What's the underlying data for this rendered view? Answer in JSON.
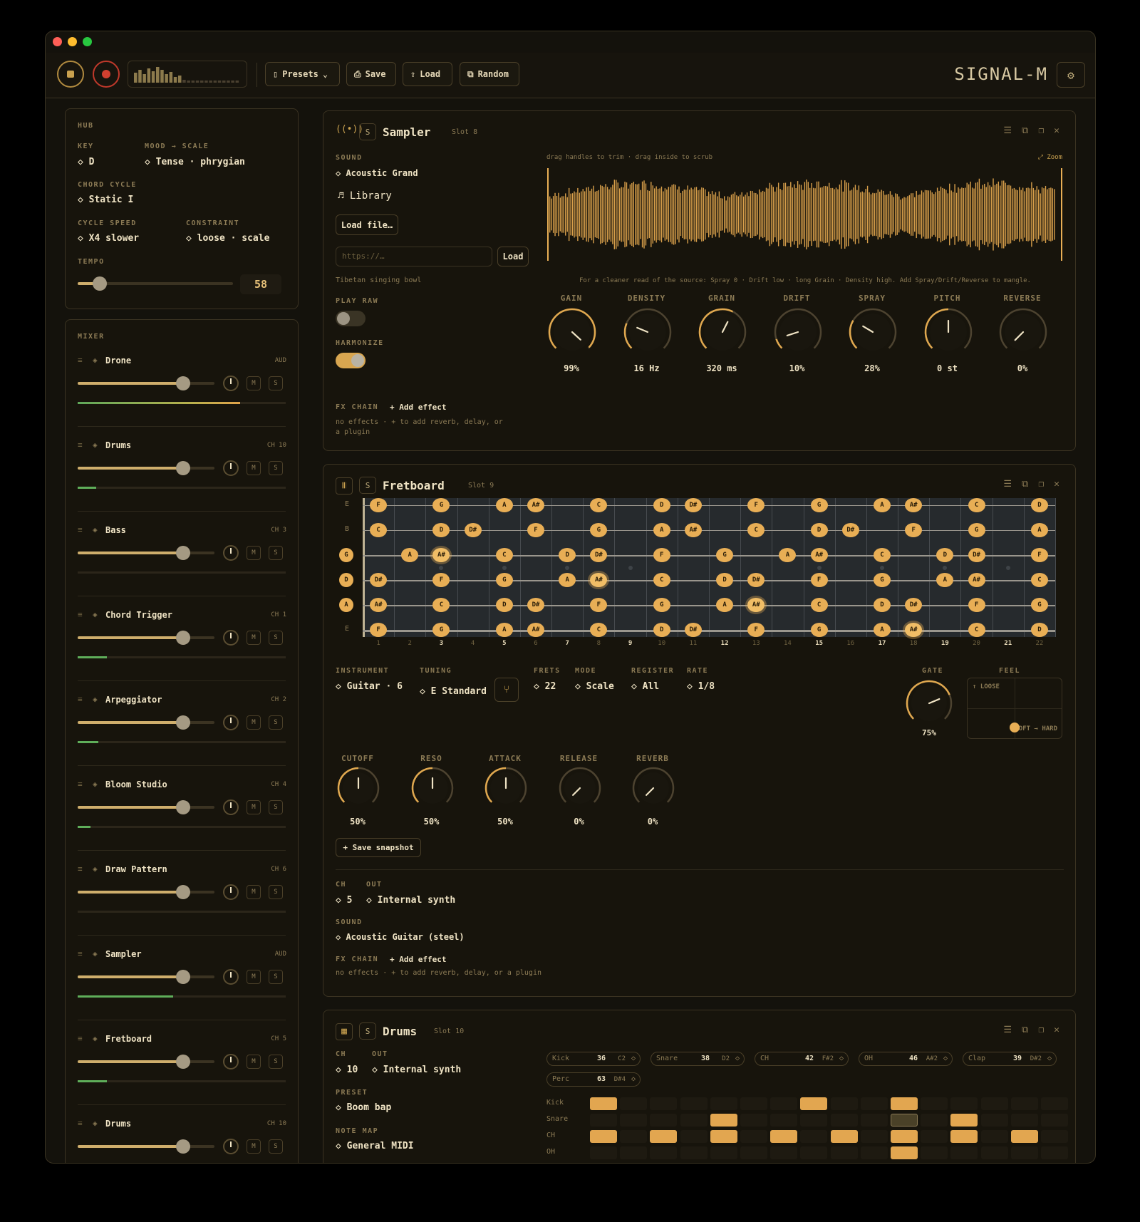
{
  "window": {
    "traffic": [
      "#ff5f57",
      "#febc2e",
      "#28c840"
    ]
  },
  "toolbar": {
    "presets": "Presets",
    "save": "Save",
    "load": "Load",
    "random": "Random",
    "brand": "SIGNAL-M"
  },
  "hub": {
    "title": "HUB",
    "key_label": "KEY",
    "key": "D",
    "mood_label": "MOOD → SCALE",
    "mood": "Tense · phrygian",
    "chord_label": "CHORD CYCLE",
    "chord": "Static I",
    "speed_label": "CYCLE SPEED",
    "speed": "X4 slower",
    "constraint_label": "CONSTRAINT",
    "constraint": "loose · scale",
    "tempo_label": "TEMPO",
    "tempo": "58",
    "tempo_level": 0.14
  },
  "mixer": {
    "title": "MIXER",
    "channels": [
      {
        "name": "Drone",
        "ch": "AUD",
        "vol": 0.77,
        "meter": 0.78,
        "meter_color": "grad"
      },
      {
        "name": "Drums",
        "ch": "CH 10",
        "vol": 0.77,
        "meter": 0.09,
        "meter_color": "green"
      },
      {
        "name": "Bass",
        "ch": "CH 3",
        "vol": 0.77,
        "meter": 0,
        "meter_color": "green"
      },
      {
        "name": "Chord Trigger",
        "ch": "CH 1",
        "vol": 0.77,
        "meter": 0.14,
        "meter_color": "green"
      },
      {
        "name": "Arpeggiator",
        "ch": "CH 2",
        "vol": 0.77,
        "meter": 0.1,
        "meter_color": "green"
      },
      {
        "name": "Bloom Studio",
        "ch": "CH 4",
        "vol": 0.77,
        "meter": 0.06,
        "meter_color": "green"
      },
      {
        "name": "Draw Pattern",
        "ch": "CH 6",
        "vol": 0.77,
        "meter": 0,
        "meter_color": "green"
      },
      {
        "name": "Sampler",
        "ch": "AUD",
        "vol": 0.77,
        "meter": 0.46,
        "meter_color": "green"
      },
      {
        "name": "Fretboard",
        "ch": "CH 5",
        "vol": 0.77,
        "meter": 0.14,
        "meter_color": "green"
      },
      {
        "name": "Drums",
        "ch": "CH 10",
        "vol": 0.77,
        "meter": 0,
        "meter_color": "green"
      }
    ],
    "mute": "M",
    "solo": "S"
  },
  "sampler": {
    "title": "Sampler",
    "slot": "Slot 8",
    "s": "S",
    "sound_label": "SOUND",
    "sound": "Acoustic Grand",
    "library": "Library",
    "load_file": "Load file…",
    "url_placeholder": "https://…",
    "load": "Load",
    "sample_name": "Tibetan singing bowl",
    "play_raw_label": "PLAY RAW",
    "harmonize_label": "HARMONIZE",
    "play_raw": false,
    "harmonize": true,
    "fx_label": "FX CHAIN",
    "add_effect": "Add effect",
    "fx_note1": "no effects · + to add reverb, delay, or",
    "fx_note2": "a plugin",
    "hint": "drag handles to trim · drag inside to scrub",
    "zoom": "Zoom",
    "tip": "For a cleaner read of the source: Spray 0 · Drift low · long Grain · Density high. Add Spray/Drift/Reverse to mangle.",
    "knobs": [
      {
        "label": "GAIN",
        "value": "99%",
        "level": 0.99
      },
      {
        "label": "DENSITY",
        "value": "16 Hz",
        "level": 0.25
      },
      {
        "label": "GRAIN",
        "value": "320 ms",
        "level": 0.6
      },
      {
        "label": "DRIFT",
        "value": "10%",
        "level": 0.1
      },
      {
        "label": "SPRAY",
        "value": "28%",
        "level": 0.28
      },
      {
        "label": "PITCH",
        "value": "0 st",
        "level": 0.5
      },
      {
        "label": "REVERSE",
        "value": "0%",
        "level": 0
      }
    ]
  },
  "fretboard": {
    "title": "Fretboard",
    "slot": "Slot 9",
    "s": "S",
    "strings": [
      "E",
      "B",
      "G",
      "D",
      "A",
      "E"
    ],
    "root_strings": [
      false,
      false,
      true,
      true,
      true,
      false
    ],
    "fret_numbers": [
      "1",
      "2",
      "3",
      "4",
      "5",
      "6",
      "7",
      "8",
      "9",
      "10",
      "11",
      "12",
      "13",
      "14",
      "15",
      "16",
      "17",
      "18",
      "19",
      "20",
      "21",
      "22"
    ],
    "notes": [
      [
        [
          1,
          "F"
        ],
        [
          3,
          "G"
        ],
        [
          5,
          "A"
        ],
        [
          6,
          "A#"
        ],
        [
          8,
          "C"
        ],
        [
          10,
          "D"
        ],
        [
          11,
          "D#"
        ],
        [
          13,
          "F"
        ],
        [
          15,
          "G"
        ],
        [
          17,
          "A"
        ],
        [
          18,
          "A#"
        ],
        [
          20,
          "C"
        ],
        [
          22,
          "D"
        ]
      ],
      [
        [
          1,
          "C"
        ],
        [
          3,
          "D"
        ],
        [
          4,
          "D#"
        ],
        [
          6,
          "F"
        ],
        [
          8,
          "G"
        ],
        [
          10,
          "A"
        ],
        [
          11,
          "A#"
        ],
        [
          13,
          "C"
        ],
        [
          15,
          "D"
        ],
        [
          16,
          "D#"
        ],
        [
          18,
          "F"
        ],
        [
          20,
          "G"
        ],
        [
          22,
          "A"
        ]
      ],
      [
        [
          2,
          "A"
        ],
        [
          3,
          "A#"
        ],
        [
          5,
          "C"
        ],
        [
          7,
          "D"
        ],
        [
          8,
          "D#"
        ],
        [
          10,
          "F"
        ],
        [
          12,
          "G"
        ],
        [
          14,
          "A"
        ],
        [
          15,
          "A#"
        ],
        [
          17,
          "C"
        ],
        [
          19,
          "D"
        ],
        [
          20,
          "D#"
        ],
        [
          22,
          "F"
        ]
      ],
      [
        [
          1,
          "D#"
        ],
        [
          3,
          "F"
        ],
        [
          5,
          "G"
        ],
        [
          7,
          "A"
        ],
        [
          8,
          "A#"
        ],
        [
          10,
          "C"
        ],
        [
          12,
          "D"
        ],
        [
          13,
          "D#"
        ],
        [
          15,
          "F"
        ],
        [
          17,
          "G"
        ],
        [
          19,
          "A"
        ],
        [
          20,
          "A#"
        ],
        [
          22,
          "C"
        ]
      ],
      [
        [
          1,
          "A#"
        ],
        [
          3,
          "C"
        ],
        [
          5,
          "D"
        ],
        [
          6,
          "D#"
        ],
        [
          8,
          "F"
        ],
        [
          10,
          "G"
        ],
        [
          12,
          "A"
        ],
        [
          13,
          "A#"
        ],
        [
          15,
          "C"
        ],
        [
          17,
          "D"
        ],
        [
          18,
          "D#"
        ],
        [
          20,
          "F"
        ],
        [
          22,
          "G"
        ]
      ],
      [
        [
          1,
          "F"
        ],
        [
          3,
          "G"
        ],
        [
          5,
          "A"
        ],
        [
          6,
          "A#"
        ],
        [
          8,
          "C"
        ],
        [
          10,
          "D"
        ],
        [
          11,
          "D#"
        ],
        [
          13,
          "F"
        ],
        [
          15,
          "G"
        ],
        [
          17,
          "A"
        ],
        [
          18,
          "A#"
        ],
        [
          20,
          "C"
        ],
        [
          22,
          "D"
        ]
      ]
    ],
    "instrument_label": "INSTRUMENT",
    "instrument": "Guitar · 6",
    "tuning_label": "TUNING",
    "tuning": "E Standard",
    "frets_label": "FRETS",
    "frets": "22",
    "mode_label": "MODE",
    "mode": "Scale",
    "register_label": "REGISTER",
    "register": "All",
    "rate_label": "RATE",
    "rate": "1/8",
    "gate_label": "GATE",
    "gate": "75%",
    "gate_level": 0.75,
    "feel_label": "FEEL",
    "feel_loose": "↑ LOOSE",
    "feel_axis": "SOFT → HARD",
    "knobs": [
      {
        "label": "CUTOFF",
        "value": "50%",
        "level": 0.5
      },
      {
        "label": "RESO",
        "value": "50%",
        "level": 0.5
      },
      {
        "label": "ATTACK",
        "value": "50%",
        "level": 0.5
      },
      {
        "label": "RELEASE",
        "value": "0%",
        "level": 0
      },
      {
        "label": "REVERB",
        "value": "0%",
        "level": 0
      }
    ],
    "snapshot": "+ Save snapshot",
    "ch_label": "CH",
    "ch": "5",
    "out_label": "OUT",
    "out": "Internal synth",
    "sound_label": "SOUND",
    "sound": "Acoustic Guitar (steel)",
    "fx_label": "FX CHAIN",
    "add_effect": "Add effect",
    "fx_note": "no effects · + to add reverb, delay, or a plugin"
  },
  "drums": {
    "title": "Drums",
    "slot": "Slot 10",
    "s": "S",
    "ch_label": "CH",
    "ch": "10",
    "out_label": "OUT",
    "out": "Internal synth",
    "preset_label": "PRESET",
    "preset": "Boom bap",
    "notemap_label": "NOTE MAP",
    "notemap": "General MIDI",
    "chips": [
      {
        "name": "Kick",
        "num": "36",
        "note": "C2"
      },
      {
        "name": "Snare",
        "num": "38",
        "note": "D2"
      },
      {
        "name": "CH",
        "num": "42",
        "note": "F#2"
      },
      {
        "name": "OH",
        "num": "46",
        "note": "A#2"
      },
      {
        "name": "Clap",
        "num": "39",
        "note": "D#2"
      },
      {
        "name": "Perc",
        "num": "63",
        "note": "D#4"
      }
    ],
    "rows": [
      {
        "name": "Kick",
        "on": [
          0,
          7,
          10
        ]
      },
      {
        "name": "Snare",
        "on": [
          4,
          12
        ]
      },
      {
        "name": "CH",
        "on": [
          0,
          2,
          4,
          6,
          8,
          10,
          12,
          14
        ]
      },
      {
        "name": "OH",
        "on": [
          10
        ]
      }
    ],
    "current_step": 10
  }
}
